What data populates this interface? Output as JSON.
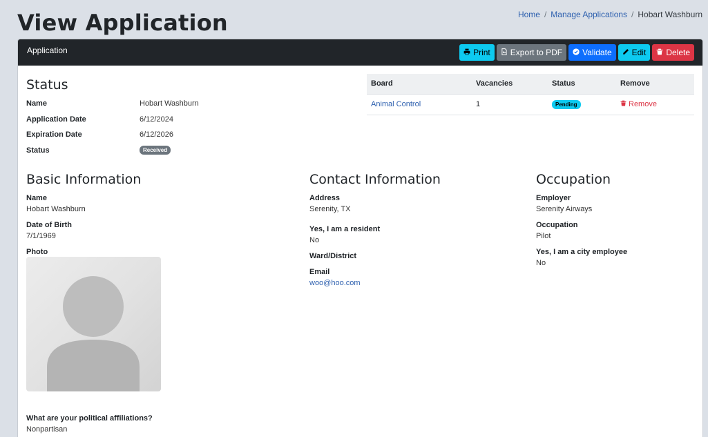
{
  "page": {
    "title": "View Application"
  },
  "breadcrumb": {
    "home": "Home",
    "manage": "Manage Applications",
    "current": "Hobart Washburn",
    "separator": "/"
  },
  "card": {
    "header_title": "Application",
    "buttons": {
      "print": "Print",
      "export": "Export to PDF",
      "validate": "Validate",
      "edit": "Edit",
      "delete": "Delete"
    }
  },
  "status": {
    "heading": "Status",
    "name_label": "Name",
    "name_value": "Hobart Washburn",
    "app_date_label": "Application Date",
    "app_date_value": "6/12/2024",
    "exp_date_label": "Expiration Date",
    "exp_date_value": "6/12/2026",
    "status_label": "Status",
    "status_badge": "Received"
  },
  "boards": {
    "headers": [
      "Board",
      "Vacancies",
      "Status",
      "Remove"
    ],
    "rows": [
      {
        "board": "Animal Control",
        "vacancies": "1",
        "status": "Pending",
        "remove": "Remove"
      }
    ]
  },
  "basic": {
    "heading": "Basic Information",
    "name_label": "Name",
    "name_value": "Hobart Washburn",
    "dob_label": "Date of Birth",
    "dob_value": "7/1/1969",
    "photo_label": "Photo",
    "political_label": "What are your political affiliations?",
    "political_value": "Nonpartisan"
  },
  "contact": {
    "heading": "Contact Information",
    "address_label": "Address",
    "address_value": "Serenity, TX",
    "resident_label": "Yes, I am a resident",
    "resident_value": "No",
    "ward_label": "Ward/District",
    "email_label": "Email",
    "email_value": "woo@hoo.com"
  },
  "occupation": {
    "heading": "Occupation",
    "employer_label": "Employer",
    "employer_value": "Serenity Airways",
    "occupation_label": "Occupation",
    "occupation_value": "Pilot",
    "city_employee_label": "Yes, I am a city employee",
    "city_employee_value": "No"
  },
  "icons": {
    "print": "printer-icon",
    "export": "pdf-file-icon",
    "validate": "check-circle-icon",
    "edit": "pencil-icon",
    "delete": "trash-icon",
    "remove": "trash-icon",
    "photo": "avatar-placeholder-icon"
  },
  "colors": {
    "header_bg": "#212529",
    "info": "#0dcaf0",
    "secondary": "#6c757d",
    "primary": "#0d6efd",
    "danger": "#dc3545",
    "link": "#2c5fae",
    "page_bg": "#dbe0e7"
  }
}
